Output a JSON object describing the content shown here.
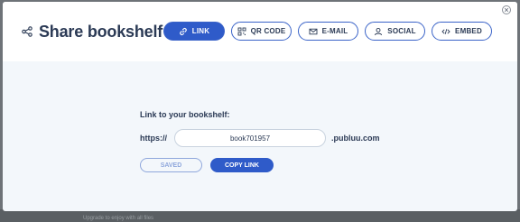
{
  "modal": {
    "title": "Share bookshelf",
    "title_icon": "share-icon",
    "close_icon": "close-icon"
  },
  "tabs": [
    {
      "label": "LINK",
      "icon": "link-icon",
      "active": true
    },
    {
      "label": "QR CODE",
      "icon": "qr-code-icon",
      "active": false
    },
    {
      "label": "E-MAIL",
      "icon": "envelope-icon",
      "active": false
    },
    {
      "label": "SOCIAL",
      "icon": "user-icon",
      "active": false
    },
    {
      "label": "EMBED",
      "icon": "code-icon",
      "active": false
    }
  ],
  "link_form": {
    "label": "Link to your bookshelf:",
    "prefix": "https://",
    "value": "book701957",
    "suffix": ".publuu.com",
    "saved_label": "SAVED",
    "copy_label": "COPY LINK"
  },
  "backdrop": {
    "text": "Upgrade to enjoy with all files"
  },
  "colors": {
    "accent": "#2f5bc9",
    "title": "#2b3a55",
    "modal_body": "#f3f7fb"
  }
}
